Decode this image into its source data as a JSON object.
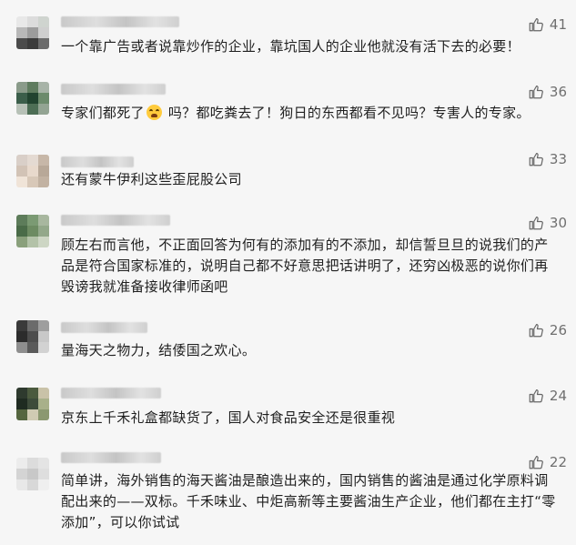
{
  "comments": [
    {
      "text": "一个靠广告或者说靠炒作的企业，靠坑国人的企业他就没有活下去的必要！",
      "likes": "41",
      "avatar": [
        "#e8e8e8",
        "#dcdcdc",
        "#cfd4cf",
        "#b8b8b8",
        "#9c9c9c",
        "#cfcfcf",
        "#4b4b4b",
        "#3b3b3b",
        "#6b6b6b"
      ]
    },
    {
      "text_before": "专家们都死了",
      "text_after": " 吗？都吃粪去了！狗日的东西都看不见吗？专害人的专家。",
      "likes": "36",
      "avatar": [
        "#8a9b8a",
        "#5f7c5f",
        "#a7b3a7",
        "#3b5e4a",
        "#21432f",
        "#6c8b6c",
        "#b7c1b7",
        "#4d6e55",
        "#93a493"
      ]
    },
    {
      "text": "还有蒙牛伊利这些歪屁股公司",
      "likes": "33",
      "avatar": [
        "#d9cfc8",
        "#e4dad2",
        "#c7b7a8",
        "#d2c3b6",
        "#e8d9cc",
        "#b8a898",
        "#f0e4d8",
        "#d8c8b8",
        "#c2b2a2"
      ]
    },
    {
      "text": "顾左右而言他，不正面回答为何有的添加有的不添加，却信誓旦旦的说我们的产品是符合国家标准的，说明自己都不好意思把话讲明了，还穷凶极恶的说你们再毁谤我就准备接收律师函吧",
      "likes": "30",
      "avatar": [
        "#5d7c5a",
        "#7b9a73",
        "#a8b79f",
        "#4a6b48",
        "#6d8b62",
        "#93a88a",
        "#8aa07c",
        "#b3c2a8",
        "#cdd6c4"
      ]
    },
    {
      "text": "量海天之物力，结倭国之欢心。",
      "likes": "26",
      "avatar": [
        "#3a3a3a",
        "#6b6b6b",
        "#9e9e9e",
        "#2c2c2c",
        "#4d4d4d",
        "#c8c8c8",
        "#8e8e8e",
        "#5a5a5a",
        "#d2d2d2"
      ]
    },
    {
      "text": "京东上千禾礼盒都缺货了，国人对食品安全还是很重视",
      "likes": "24",
      "avatar": [
        "#2e3a2e",
        "#4b5a3e",
        "#c9c2a8",
        "#1f2b21",
        "#3d4b3a",
        "#a8b08a",
        "#55663f",
        "#d0cbb3",
        "#8b9870"
      ]
    },
    {
      "text": "简单讲，海外销售的海天酱油是酿造出来的，国内销售的酱油是通过化学原料调配出来的——双标。千禾味业、中炬高新等主要酱油生产企业，他们都在主打“零添加”，可以你试试",
      "likes": "22",
      "avatar": [
        "#ececec",
        "#dcdcdc",
        "#e4e4e4",
        "#d4d4d4",
        "#c8c8c8",
        "#dedede",
        "#e8e8e8",
        "#d8d8d8",
        "#efefef"
      ]
    }
  ]
}
